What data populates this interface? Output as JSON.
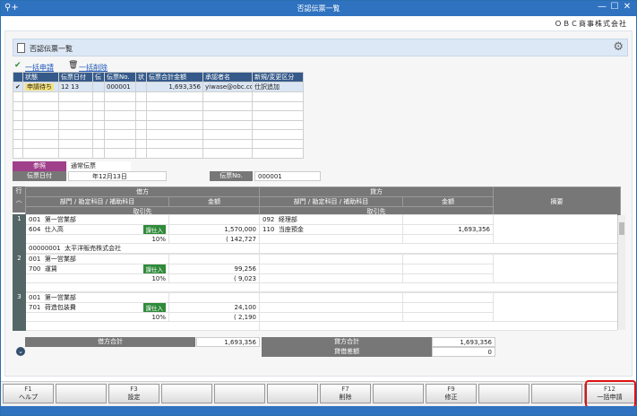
{
  "window": {
    "title": "否認伝票一覧",
    "logo": "⚲+",
    "min": "—",
    "max": "☐",
    "close": "✕",
    "company": "ＯＢＣ商事株式会社"
  },
  "header": {
    "title": "否認伝票一覧",
    "gear": "⚙"
  },
  "actions": {
    "bulk_apply": "一括申請",
    "bulk_delete": "一括削除"
  },
  "list": {
    "columns": [
      "",
      "状態",
      "伝票日付",
      "伝",
      "伝票No.",
      "状",
      "伝票合計金額",
      "承認者名",
      "新規/変更区分"
    ],
    "rows": [
      {
        "status": "申請待ち",
        "date": "12 13",
        "no": "000001",
        "total": "1,693,356",
        "approver": "yiwase@obc.co.jp",
        "kind": "仕訳追加"
      }
    ]
  },
  "detail": {
    "ref_label": "参照",
    "ref_value": "通常伝票",
    "date_label": "伝票日付",
    "date_value": "年12月13日",
    "no_label": "伝票No.",
    "no_value": "000001",
    "row_hdr": "行",
    "debit": "借方",
    "credit": "貸方",
    "dept_hdr": "部門 / 勘定科目 / 補助科目",
    "amount_hdr": "金額",
    "partner_hdr": "取引先",
    "memo_hdr": "摘要",
    "lines": [
      {
        "n": "1",
        "d1": "001",
        "d1n": "第一営業部",
        "d2": "604",
        "d2n": "仕入高",
        "tax": "課仕入",
        "amt": "1,570,000",
        "rate": "10%",
        "taxamt": "( 142,727",
        "c1": "092",
        "c1n": "経理部",
        "c2": "110",
        "c2n": "当座預金",
        "camt": "1,693,356",
        "partner_code": "00000001",
        "partner_name": "太平洋販売株式会社"
      },
      {
        "n": "2",
        "d1": "001",
        "d1n": "第一営業部",
        "d2": "700",
        "d2n": "運賃",
        "tax": "課仕入",
        "amt": "99,256",
        "rate": "10%",
        "taxamt": "( 9,023"
      },
      {
        "n": "3",
        "d1": "001",
        "d1n": "第一営業部",
        "d2": "701",
        "d2n": "荷造包装費",
        "tax": "課仕入",
        "amt": "24,100",
        "rate": "10%",
        "taxamt": "( 2,190"
      }
    ],
    "debit_total_label": "借方合計",
    "debit_total": "1,693,356",
    "credit_total_label": "貸方合計",
    "credit_total": "1,693,356",
    "diff_label": "貸借差額",
    "diff": "0"
  },
  "fkeys": [
    {
      "n": "F1",
      "l": "ヘルプ"
    },
    {
      "n": "",
      "l": ""
    },
    {
      "n": "F3",
      "l": "設定"
    },
    {
      "n": "",
      "l": ""
    },
    {
      "n": "",
      "l": ""
    },
    {
      "n": "",
      "l": ""
    },
    {
      "n": "F7",
      "l": "削除"
    },
    {
      "n": "",
      "l": ""
    },
    {
      "n": "F9",
      "l": "修正"
    },
    {
      "n": "",
      "l": ""
    },
    {
      "n": "",
      "l": ""
    },
    {
      "n": "F12",
      "l": "一括申請"
    }
  ]
}
